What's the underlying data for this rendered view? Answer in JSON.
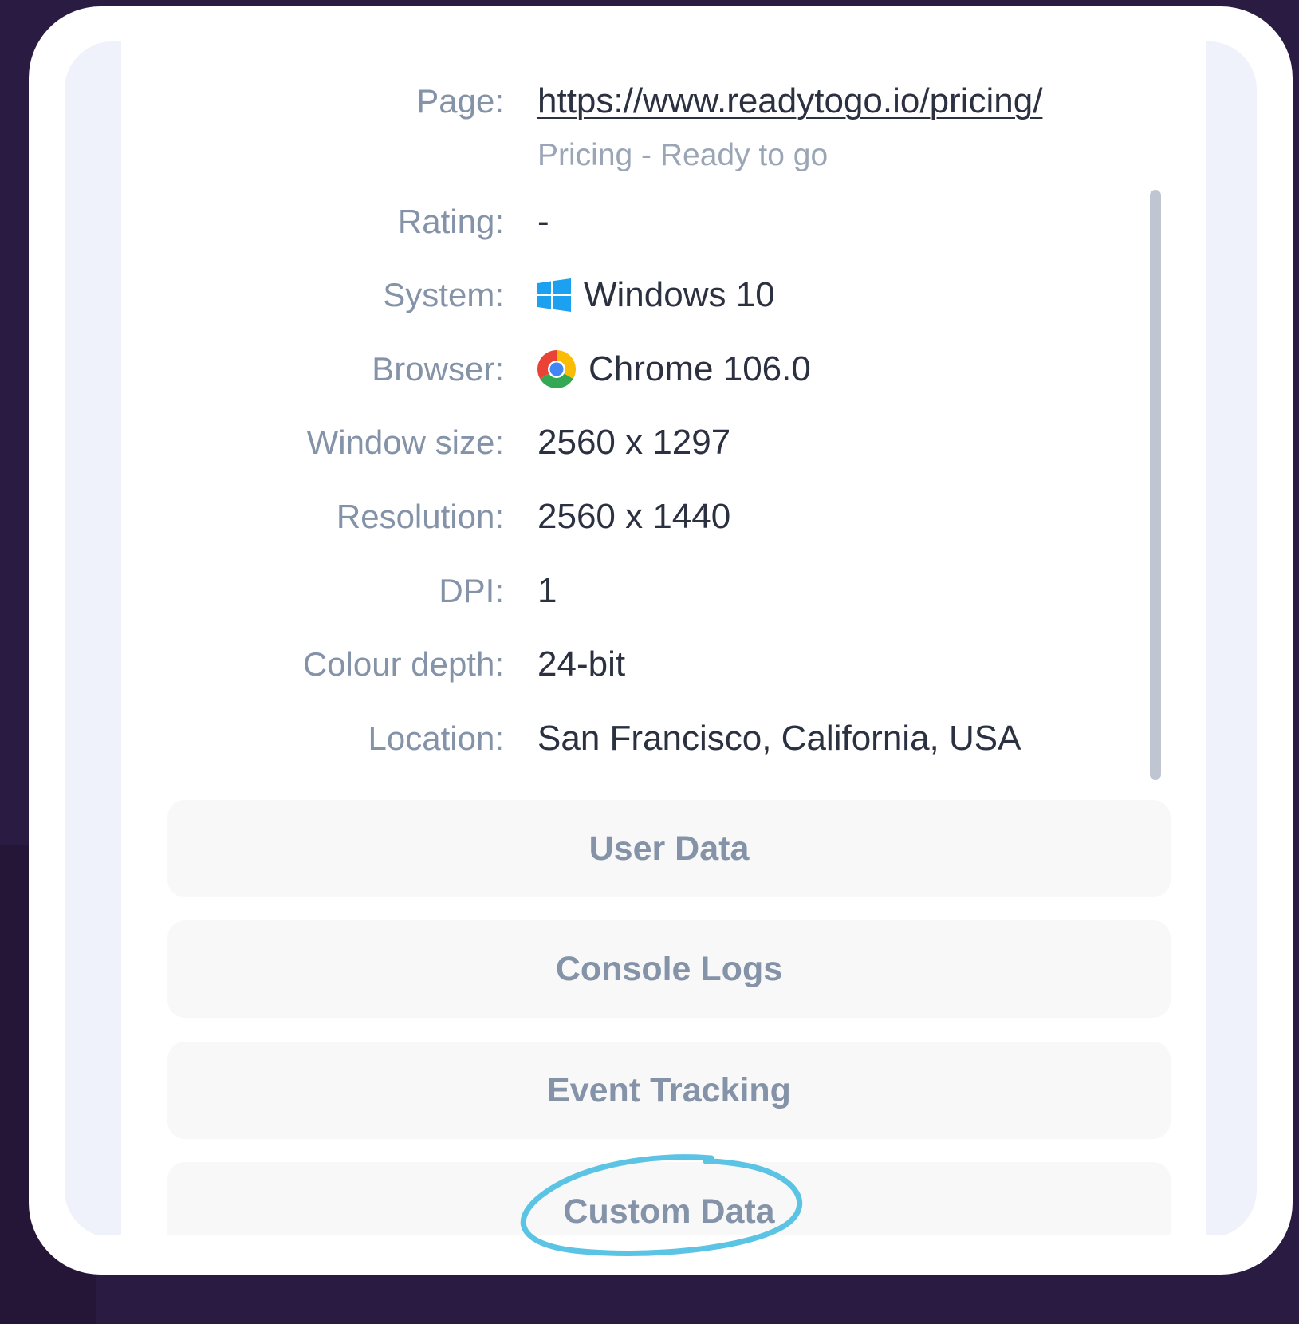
{
  "details": {
    "page": {
      "label": "Page:",
      "url": "https://www.readytogo.io/pricing/",
      "title": "Pricing - Ready to go"
    },
    "rating": {
      "label": "Rating:",
      "value": "-"
    },
    "system": {
      "label": "System:",
      "value": "Windows 10",
      "icon": "windows-icon"
    },
    "browser": {
      "label": "Browser:",
      "value": "Chrome 106.0",
      "icon": "chrome-icon"
    },
    "window_size": {
      "label": "Window size:",
      "value": "2560 x 1297"
    },
    "resolution": {
      "label": "Resolution:",
      "value": "2560 x 1440"
    },
    "dpi": {
      "label": "DPI:",
      "value": "1"
    },
    "colour_depth": {
      "label": "Colour depth:",
      "value": "24-bit"
    },
    "location": {
      "label": "Location:",
      "value": "San Francisco, California, USA"
    }
  },
  "buttons": {
    "user_data": "User Data",
    "console_logs": "Console Logs",
    "event_tracking": "Event Tracking",
    "custom_data": "Custom Data"
  },
  "colors": {
    "background": "#2a1b43",
    "label": "#8493a8",
    "value": "#2b3140",
    "highlight": "#5bc3e3",
    "windows_blue": "#1ba1f0"
  }
}
